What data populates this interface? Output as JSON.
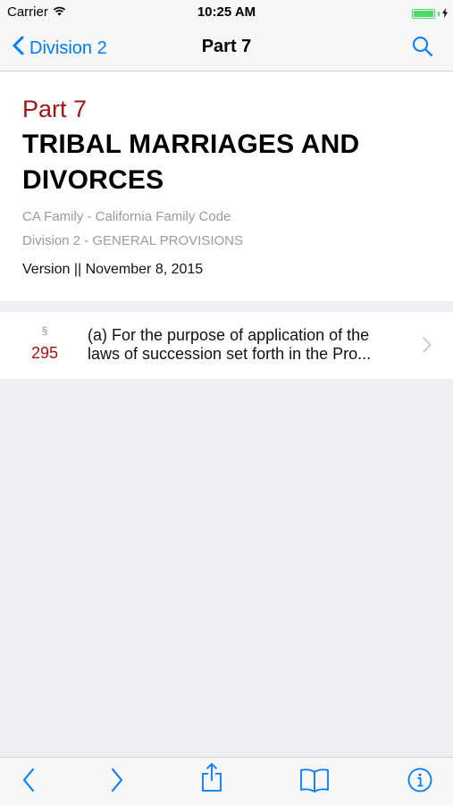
{
  "status_bar": {
    "carrier": "Carrier",
    "time": "10:25 AM",
    "battery_level": 1.0
  },
  "nav": {
    "back_label": "Division 2",
    "title": "Part 7",
    "accent_color": "#007aff"
  },
  "header": {
    "part_label": "Part 7",
    "title": "TRIBAL MARRIAGES AND DIVORCES",
    "breadcrumbs": [
      "CA Family - California Family Code",
      "Division 2 - GENERAL PROVISIONS"
    ],
    "version": "Version || November 8, 2015",
    "part_color": "#a31515"
  },
  "sections": [
    {
      "symbol": "§",
      "number": "295",
      "preview": "(a) For the purpose of application of the laws of succession set forth in the Pro..."
    }
  ],
  "toolbar": {
    "icons": [
      "back-arrow-icon",
      "forward-arrow-icon",
      "share-icon",
      "book-icon",
      "info-icon"
    ]
  }
}
